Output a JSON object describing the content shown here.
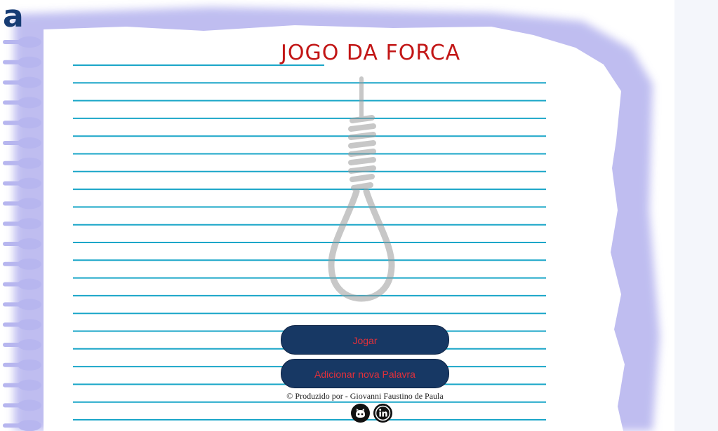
{
  "logo": {
    "letter": "a"
  },
  "title": "JOGO DA FORCA",
  "buttons": {
    "play": "Jogar",
    "add_word": "Adicionar nova Palavra"
  },
  "footer": {
    "credits": "© Produzido por - Giovanni Faustino de Paula"
  },
  "social": {
    "github_icon": "github-icon",
    "linkedin_icon": "linkedin-icon"
  },
  "colors": {
    "title": "#c21616",
    "button_bg": "#173864",
    "button_text": "#e3303a",
    "ruled_line": "#1aa6c8",
    "paper_edge": "#b9b8ee",
    "logo": "#173c74"
  }
}
